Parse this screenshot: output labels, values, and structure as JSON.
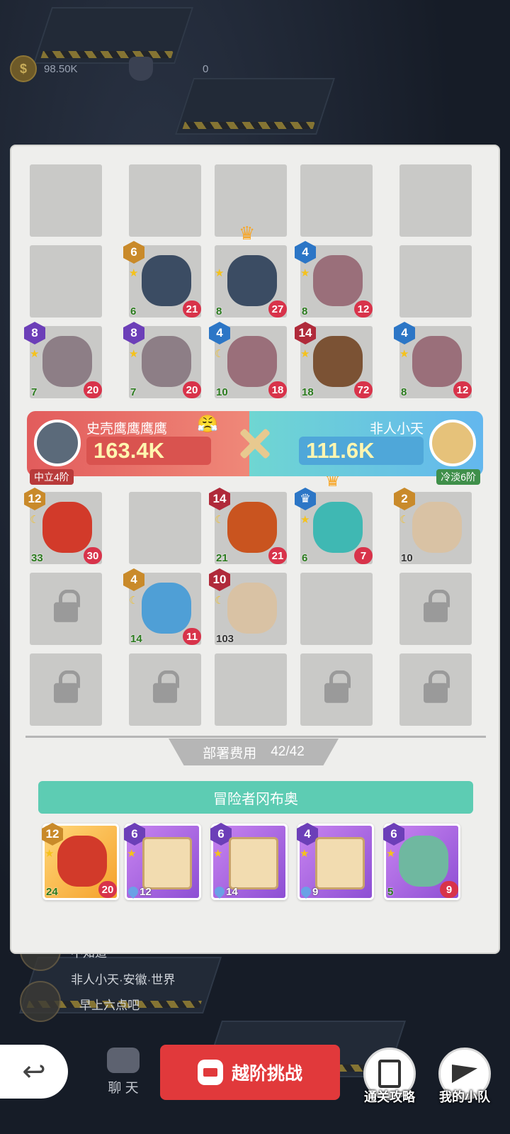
{
  "top_stats": {
    "coins": "98.50K",
    "shields": "0"
  },
  "board_enemy": [
    {
      "row": 0,
      "col": 0,
      "empty": true
    },
    {
      "row": 0,
      "col": 1,
      "empty": true
    },
    {
      "row": 0,
      "col": 2,
      "empty": true
    },
    {
      "row": 0,
      "col": 3,
      "empty": true
    },
    {
      "row": 0,
      "col": 4,
      "empty": true
    },
    {
      "row": 1,
      "col": 0,
      "empty": true
    },
    {
      "row": 1,
      "col": 1,
      "level": "6",
      "level_color": "orange",
      "marker": "star",
      "atk": "6",
      "hp": "21",
      "creature": "eagle-warrior",
      "color": "#3b4c63"
    },
    {
      "row": 1,
      "col": 2,
      "crown": true,
      "marker": "star",
      "atk": "8",
      "hp": "27",
      "creature": "eagle-warrior",
      "color": "#3b4c63"
    },
    {
      "row": 1,
      "col": 3,
      "level": "4",
      "level_color": "blue",
      "marker": "star",
      "atk": "8",
      "hp": "12",
      "creature": "werewolf",
      "color": "#9a6f7a"
    },
    {
      "row": 1,
      "col": 4,
      "empty": true
    },
    {
      "row": 2,
      "col": 0,
      "level": "8",
      "level_color": "purple",
      "marker": "star",
      "atk": "7",
      "hp": "20",
      "creature": "mammoth-shield",
      "color": "#8d7e86"
    },
    {
      "row": 2,
      "col": 1,
      "level": "8",
      "level_color": "purple",
      "marker": "star",
      "atk": "7",
      "hp": "20",
      "creature": "mammoth-shield",
      "color": "#8d7e86"
    },
    {
      "row": 2,
      "col": 2,
      "level": "4",
      "level_color": "blue",
      "marker": "moon",
      "atk": "10",
      "hp": "18",
      "creature": "werewolf",
      "color": "#9a6f7a"
    },
    {
      "row": 2,
      "col": 3,
      "level": "14",
      "level_color": "red",
      "marker": "star",
      "atk": "18",
      "hp": "72",
      "creature": "tiger-boss",
      "color": "#7b5234"
    },
    {
      "row": 2,
      "col": 4,
      "level": "4",
      "level_color": "blue",
      "marker": "star",
      "atk": "8",
      "hp": "12",
      "creature": "werewolf",
      "color": "#9a6f7a"
    }
  ],
  "versus": {
    "left_name": "史壳鹰鹰鹰鹰",
    "left_power": "163.4K",
    "left_rank": "中立4阶",
    "right_name": "非人小天",
    "right_power": "111.6K",
    "right_rank": "冷淡6阶"
  },
  "board_player": [
    {
      "row": 0,
      "col": 0,
      "level": "12",
      "level_color": "orange",
      "marker": "moon",
      "atk": "33",
      "hp": "30",
      "creature": "fire-demon",
      "color": "#d23a2a"
    },
    {
      "row": 0,
      "col": 1,
      "empty": true
    },
    {
      "row": 0,
      "col": 2,
      "level": "14",
      "level_color": "red",
      "marker": "moon",
      "atk": "21",
      "hp": "21",
      "creature": "lava-golem",
      "color": "#c9541f"
    },
    {
      "row": 0,
      "col": 3,
      "crown": true,
      "badge": "crown",
      "level_color": "blue",
      "marker": "star",
      "atk": "6",
      "hp": "7",
      "creature": "teal-slime",
      "color": "#3fb8b3"
    },
    {
      "row": 0,
      "col": 4,
      "level": "2",
      "level_color": "orange",
      "marker": "moon",
      "stone": "10",
      "creature": "crystal-rune",
      "color": "#d9c2a4"
    },
    {
      "row": 1,
      "col": 0,
      "locked": true
    },
    {
      "row": 1,
      "col": 1,
      "level": "4",
      "level_color": "orange",
      "marker": "moon",
      "atk": "14",
      "hp": "11",
      "creature": "ice-wizard",
      "color": "#4f9fd6"
    },
    {
      "row": 1,
      "col": 2,
      "level": "10",
      "level_color": "red",
      "marker": "moon",
      "stone": "103",
      "creature": "mushroom-rune",
      "color": "#d9c2a4"
    },
    {
      "row": 1,
      "col": 3,
      "empty": true
    },
    {
      "row": 1,
      "col": 4,
      "locked": true
    },
    {
      "row": 2,
      "col": 0,
      "locked": true
    },
    {
      "row": 2,
      "col": 1,
      "locked": true
    },
    {
      "row": 2,
      "col": 2,
      "empty": true
    },
    {
      "row": 2,
      "col": 3,
      "locked": true
    },
    {
      "row": 2,
      "col": 4,
      "locked": true
    }
  ],
  "deploy": {
    "label": "部署费用",
    "value": "42/42"
  },
  "adventurer_name": "冒险者冈布奥",
  "cards": [
    {
      "level": "12",
      "level_color": "orange",
      "style": "gold",
      "kind": "creature",
      "atk": "24",
      "hp": "20",
      "creature": "fire-demon",
      "color": "#d23a2a"
    },
    {
      "level": "6",
      "level_color": "purple",
      "style": "violet",
      "kind": "scroll",
      "count": "12",
      "symbol": "spiral-rune"
    },
    {
      "level": "6",
      "level_color": "purple",
      "style": "violet",
      "kind": "scroll",
      "count": "14",
      "symbol": "heart-rune"
    },
    {
      "level": "4",
      "level_color": "purple",
      "style": "violet",
      "kind": "scroll",
      "count": "9",
      "symbol": "fire-rune"
    },
    {
      "level": "6",
      "level_color": "purple",
      "style": "violet",
      "kind": "creature",
      "atk": "5",
      "hp": "9",
      "creature": "angel-slime",
      "color": "#6fb8a0"
    }
  ],
  "chat": [
    {
      "text": "不知道"
    },
    {
      "text": "非人小天·安徽·世界"
    },
    {
      "text": "早上六点吧"
    }
  ],
  "bottom": {
    "back": "↩",
    "chat": "聊 天",
    "challenge": "越阶挑战",
    "guide": "通关攻略",
    "team": "我的小队"
  }
}
